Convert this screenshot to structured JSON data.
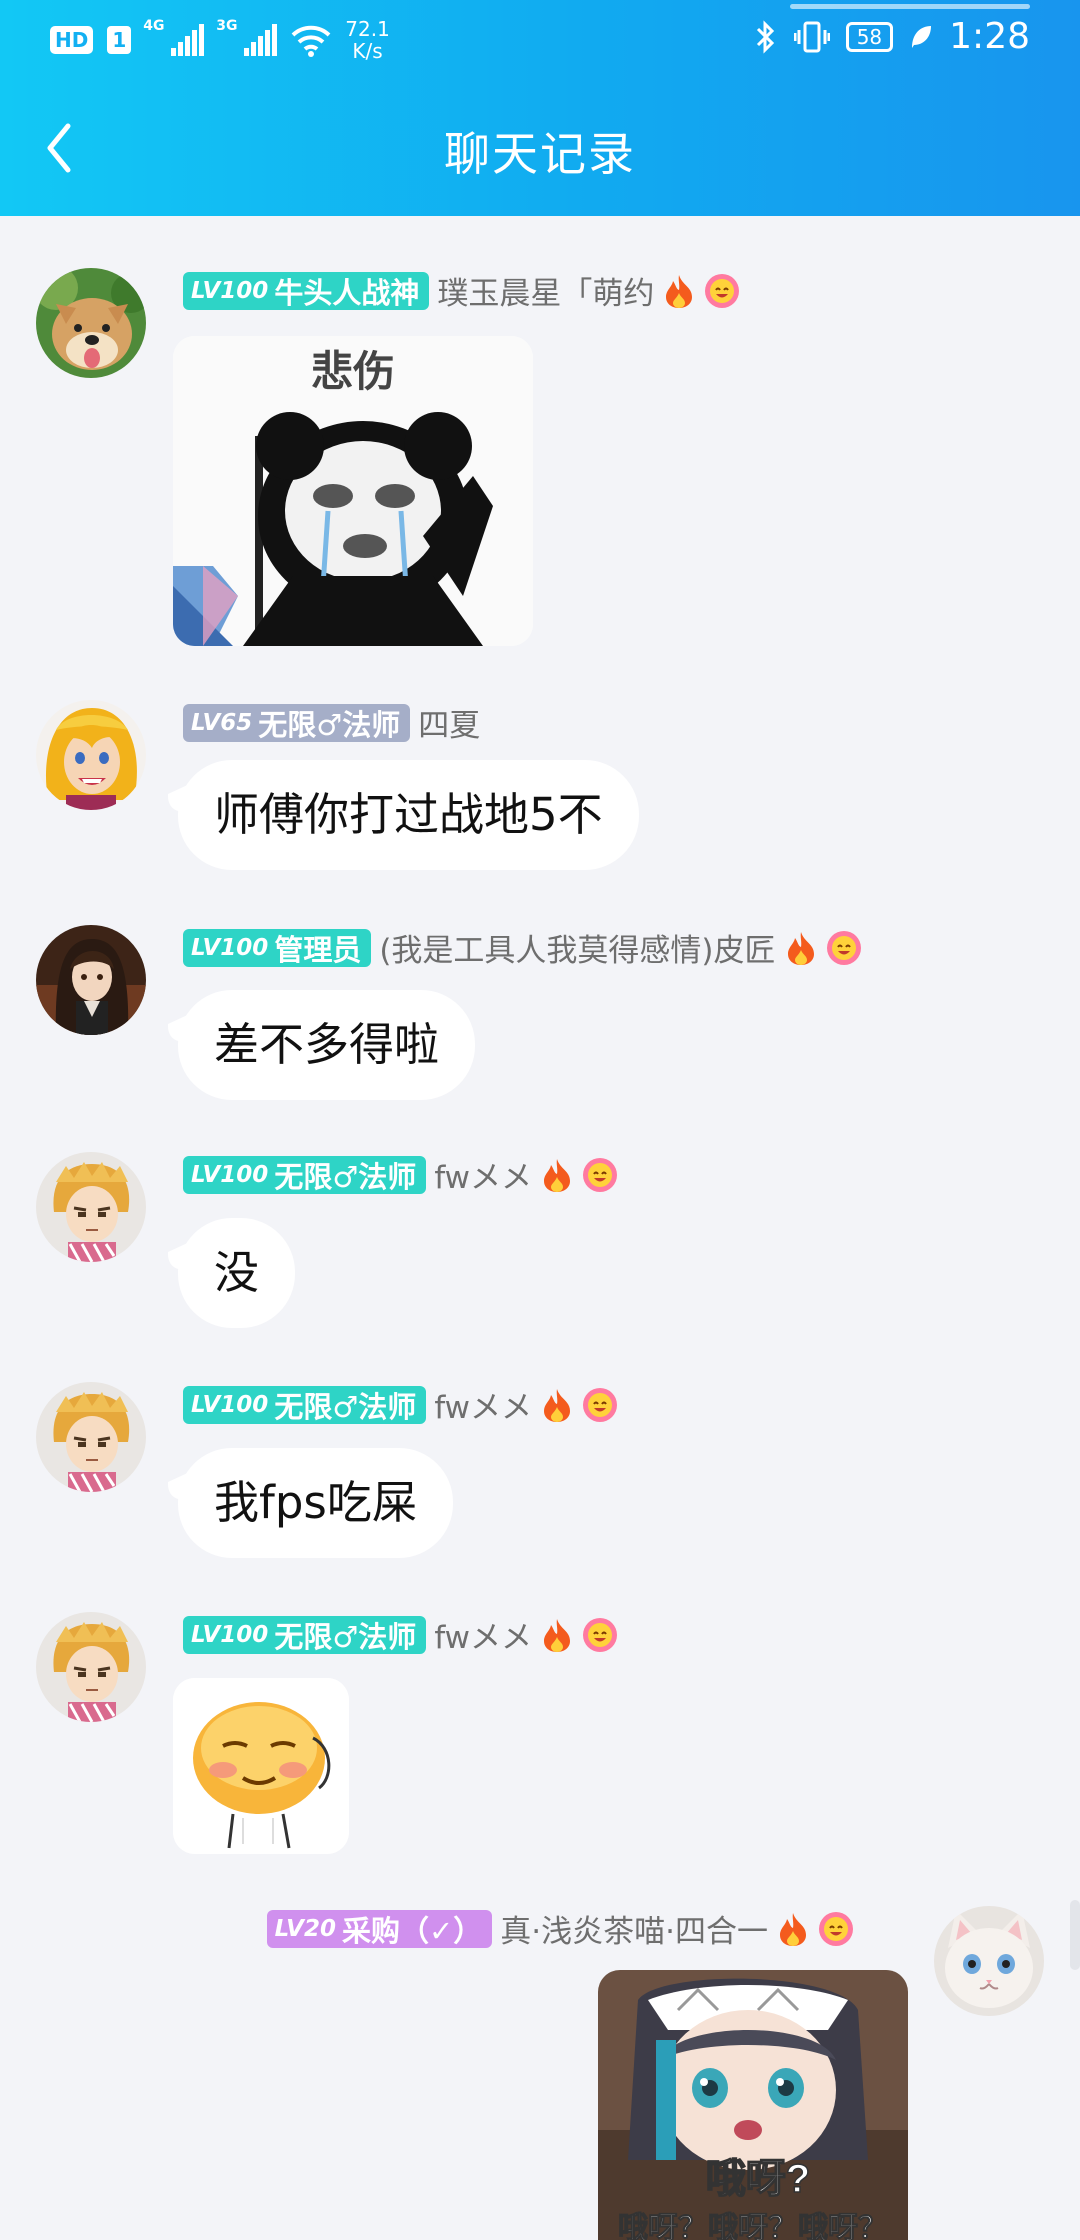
{
  "status_bar": {
    "hd_label": "HD",
    "sim_label": "1",
    "sim1_tag": "4G",
    "sim2_tag": "3G",
    "speed_value": "72.1",
    "speed_unit": "K/s",
    "battery": "58",
    "time": "1:28"
  },
  "header": {
    "title": "聊天记录"
  },
  "messages": [
    {
      "level": "LV100",
      "title": "牛头人战神",
      "nick": "璞玉晨星「萌约",
      "sticker_text": "悲伤"
    },
    {
      "level": "LV65",
      "title": "无限♂法师",
      "nick": "四夏",
      "text": "师傅你打过战地5不"
    },
    {
      "level": "LV100",
      "title": "管理员",
      "nick": "(我是工具人我莫得感情)皮匠",
      "text": "差不多得啦"
    },
    {
      "level": "LV100",
      "title": "无限♂法师",
      "nick": "fwメメ",
      "text": "没"
    },
    {
      "level": "LV100",
      "title": "无限♂法师",
      "nick": "fwメメ",
      "text": "我fps吃屎"
    },
    {
      "level": "LV100",
      "title": "无限♂法师",
      "nick": "fwメメ"
    },
    {
      "level": "LV20",
      "title": "采购（✓）",
      "nick": "真·浅炎茶喵·四合一",
      "sticker_text_1": "哦呀?",
      "sticker_text_2": "哦呀？哦呀？哦呀？"
    }
  ],
  "colors": {
    "header_start": "#12c8f5",
    "header_end": "#1895ee",
    "badge_teal": "#2ed4c6",
    "badge_gray": "#a5aec8",
    "badge_purple": "#d090ee",
    "background": "#f3f4f8"
  }
}
